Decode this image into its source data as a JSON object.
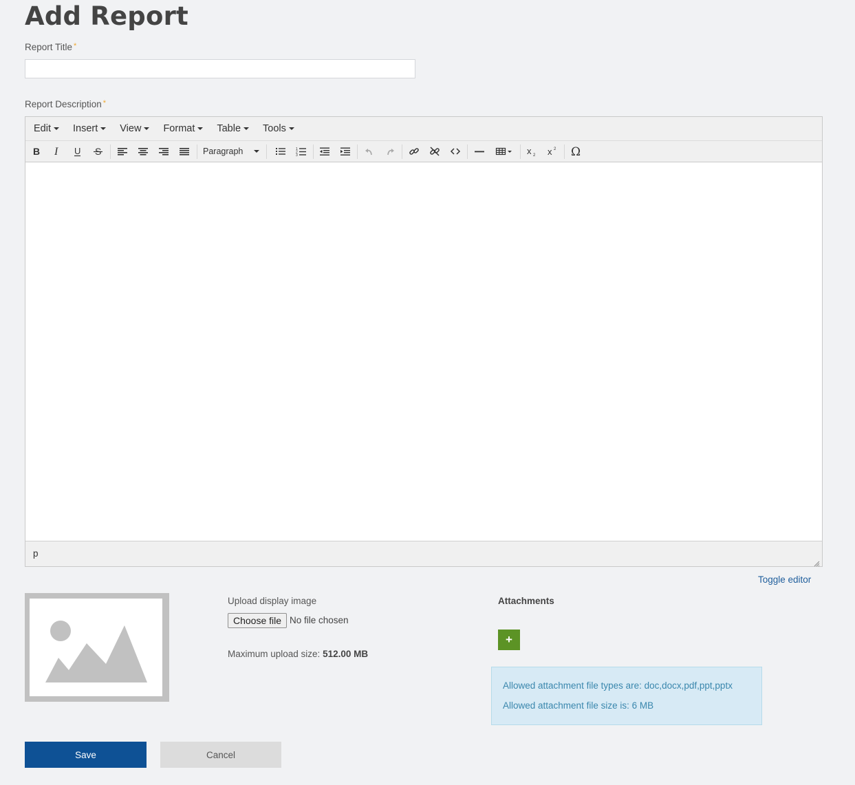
{
  "page": {
    "title": "Add Report"
  },
  "form": {
    "title_label": "Report Title",
    "title_value": "",
    "required_mark": "*",
    "description_label": "Report Description"
  },
  "editor": {
    "menus": [
      "Edit",
      "Insert",
      "View",
      "Format",
      "Table",
      "Tools"
    ],
    "format_select": "Paragraph",
    "status_path": "p",
    "toggle_label": "Toggle editor",
    "toolbar_icons": [
      "bold-icon",
      "italic-icon",
      "underline-icon",
      "strikethrough-icon",
      "align-left-icon",
      "align-center-icon",
      "align-right-icon",
      "align-justify-icon",
      "bullet-list-icon",
      "numbered-list-icon",
      "outdent-icon",
      "indent-icon",
      "undo-icon",
      "redo-icon",
      "link-icon",
      "unlink-icon",
      "code-icon",
      "horizontal-rule-icon",
      "table-icon",
      "subscript-icon",
      "superscript-icon",
      "special-char-icon"
    ]
  },
  "upload": {
    "label": "Upload display image",
    "choose_label": "Choose file",
    "no_file": "No file chosen",
    "max_prefix": "Maximum upload size:",
    "max_value": "512.00 MB"
  },
  "attachments": {
    "heading": "Attachments",
    "add_label": "+",
    "types_text": "Allowed attachment file types are: doc,docx,pdf,ppt,pptx",
    "size_text": "Allowed attachment file size is: 6 MB"
  },
  "actions": {
    "save": "Save",
    "cancel": "Cancel"
  },
  "colors": {
    "primary": "#0e5195",
    "add_green": "#5c9325",
    "info_bg": "#d7eaf5",
    "info_text": "#3a87ad",
    "required": "#f0a830"
  }
}
